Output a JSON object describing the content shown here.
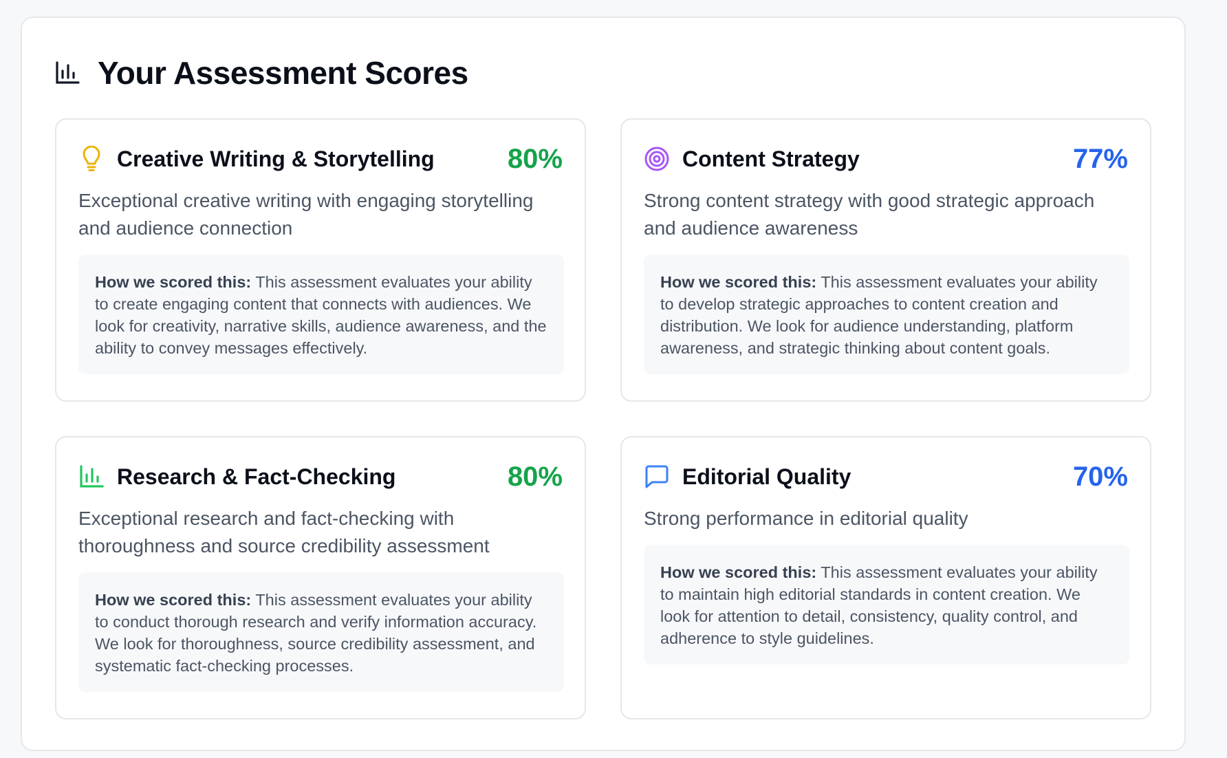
{
  "header": {
    "icon": "bar-chart-icon",
    "title": "Your Assessment Scores"
  },
  "colors": {
    "green": "#16a34a",
    "blue": "#2563eb",
    "yellow": "#eab308",
    "purple": "#a855f7",
    "chart_green": "#22c55e",
    "message_blue": "#3b82f6"
  },
  "cards": [
    {
      "icon": "lightbulb-icon",
      "title": "Creative Writing & Storytelling",
      "score": "80%",
      "score_color": "#16a34a",
      "description": "Exceptional creative writing with engaging storytelling and audience connection",
      "method_lead": "How we scored this:",
      "method_text": "This assessment evaluates your ability to create engaging content that connects with audiences. We look for creativity, narrative skills, audience awareness, and the ability to convey messages effectively."
    },
    {
      "icon": "target-icon",
      "title": "Content Strategy",
      "score": "77%",
      "score_color": "#2563eb",
      "description": "Strong content strategy with good strategic approach and audience awareness",
      "method_lead": "How we scored this:",
      "method_text": "This assessment evaluates your ability to develop strategic approaches to content creation and distribution. We look for audience understanding, platform awareness, and strategic thinking about content goals."
    },
    {
      "icon": "bar-chart-icon",
      "title": "Research & Fact-Checking",
      "score": "80%",
      "score_color": "#16a34a",
      "description": "Exceptional research and fact-checking with thoroughness and source credibility assessment",
      "method_lead": "How we scored this:",
      "method_text": "This assessment evaluates your ability to conduct thorough research and verify information accuracy. We look for thoroughness, source credibility assessment, and systematic fact-checking processes."
    },
    {
      "icon": "message-square-icon",
      "title": "Editorial Quality",
      "score": "70%",
      "score_color": "#2563eb",
      "description": "Strong performance in editorial quality",
      "method_lead": "How we scored this:",
      "method_text": "This assessment evaluates your ability to maintain high editorial standards in content creation. We look for attention to detail, consistency, quality control, and adherence to style guidelines."
    }
  ]
}
